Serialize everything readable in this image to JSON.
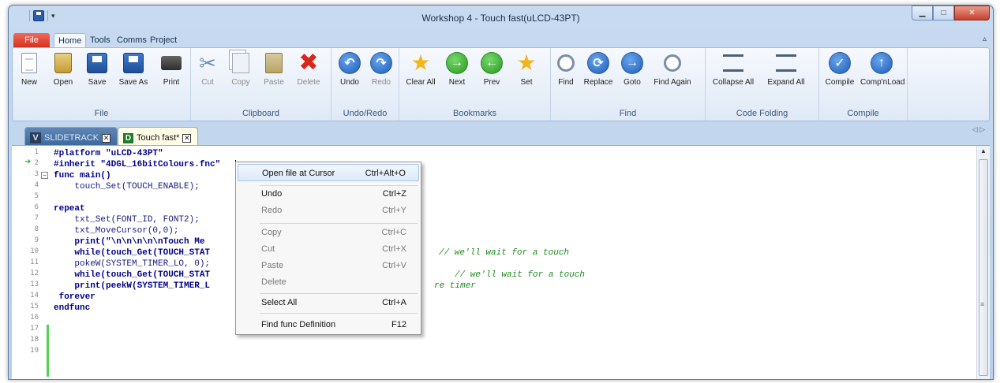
{
  "window": {
    "title": "Workshop 4 - Touch fast(uLCD-43PT)"
  },
  "ribbon_tabs": {
    "file": "File",
    "home": "Home",
    "tools": "Tools",
    "comms": "Comms",
    "project": "Project"
  },
  "ribbon": {
    "file_group": {
      "title": "File",
      "new": "New",
      "open": "Open",
      "save": "Save",
      "save_as": "Save As",
      "print": "Print"
    },
    "clipboard_group": {
      "title": "Clipboard",
      "cut": "Cut",
      "copy": "Copy",
      "paste": "Paste",
      "delete": "Delete"
    },
    "undoredo_group": {
      "title": "Undo/Redo",
      "undo": "Undo",
      "redo": "Redo"
    },
    "bookmarks_group": {
      "title": "Bookmarks",
      "clear_all": "Clear All",
      "next": "Next",
      "prev": "Prev",
      "set": "Set"
    },
    "find_group": {
      "title": "Find",
      "find": "Find",
      "replace": "Replace",
      "goto": "Goto",
      "find_again": "Find Again"
    },
    "codefold_group": {
      "title": "Code Folding",
      "collapse_all": "Collapse All",
      "expand_all": "Expand All"
    },
    "compile_group": {
      "title": "Compile",
      "compile": "Compile",
      "compnload": "Comp'nLoad"
    }
  },
  "doc_tabs": [
    {
      "label": "SLIDETRACK",
      "logo": "V"
    },
    {
      "label": "Touch fast*",
      "logo": "D"
    }
  ],
  "editor": {
    "line_numbers": [
      "1",
      "2",
      "3",
      "4",
      "5",
      "6",
      "7",
      "8",
      "9",
      "10",
      "11",
      "12",
      "13",
      "14",
      "15",
      "16",
      "17",
      "18",
      "19"
    ],
    "lines": {
      "l1": "#platform \"uLCD-43PT\"",
      "l2": "#inherit \"4DGL_16bitColours.fnc\"",
      "l3": "func main()",
      "l4": "    touch_Set(TOUCH_ENABLE);",
      "l6": "repeat",
      "l7": "    txt_Set(FONT_ID, FONT2);",
      "l8": "    txt_MoveCursor(0,0);",
      "l9": "    print(\"\\n\\n\\n\\n\\nTouch Me ",
      "l10": "    while(touch_Get(TOUCH_STAT",
      "l10c": "// we'll wait for a touch",
      "l11": "    pokeW(SYSTEM_TIMER_LO, 0);",
      "l12": "    while(touch_Get(TOUCH_STAT",
      "l12c": "// we'll wait for a touch",
      "l13": "    print(peekW(SYSTEM_TIMER_L",
      "l13c": "re timer",
      "l14": " forever",
      "l15": "endfunc"
    }
  },
  "context_menu": {
    "open_file": {
      "label": "Open file at Cursor",
      "shortcut": "Ctrl+Alt+O"
    },
    "undo": {
      "label": "Undo",
      "shortcut": "Ctrl+Z"
    },
    "redo": {
      "label": "Redo",
      "shortcut": "Ctrl+Y"
    },
    "copy": {
      "label": "Copy",
      "shortcut": "Ctrl+C"
    },
    "cut": {
      "label": "Cut",
      "shortcut": "Ctrl+X"
    },
    "paste": {
      "label": "Paste",
      "shortcut": "Ctrl+V"
    },
    "delete": {
      "label": "Delete",
      "shortcut": ""
    },
    "select_all": {
      "label": "Select All",
      "shortcut": "Ctrl+A"
    },
    "find_func": {
      "label": "Find func Definition",
      "shortcut": "F12"
    }
  },
  "colors": {
    "accent": "#2b5da8",
    "file_tab": "#d2321f",
    "modified_bar": "#55d155",
    "comment": "#1f8a1f"
  }
}
